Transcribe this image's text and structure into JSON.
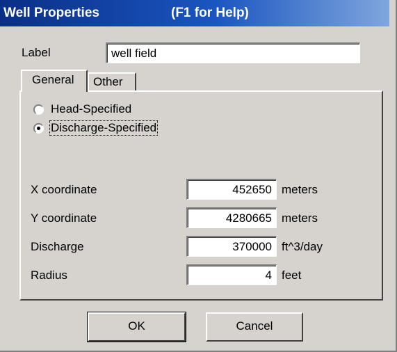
{
  "window": {
    "title": "Well Properties",
    "help_hint": "(F1 for Help)"
  },
  "label_row": {
    "caption": "Label",
    "value": "well field"
  },
  "tabs": [
    {
      "label": "General",
      "selected": true
    },
    {
      "label": "Other",
      "selected": false
    }
  ],
  "well_type": {
    "options": [
      {
        "label": "Head-Specified",
        "checked": false
      },
      {
        "label": "Discharge-Specified",
        "checked": true
      }
    ]
  },
  "fields": [
    {
      "label": "X coordinate",
      "value": "452650",
      "unit": "meters"
    },
    {
      "label": "Y coordinate",
      "value": "4280665",
      "unit": "meters"
    },
    {
      "label": "Discharge",
      "value": "370000",
      "unit": "ft^3/day"
    },
    {
      "label": "Radius",
      "value": "4",
      "unit": "feet"
    }
  ],
  "buttons": {
    "ok": "OK",
    "cancel": "Cancel"
  },
  "colors": {
    "titlebar_start": "#0a2f86",
    "titlebar_end": "#7fa6dd",
    "face": "#d6d3ce"
  }
}
